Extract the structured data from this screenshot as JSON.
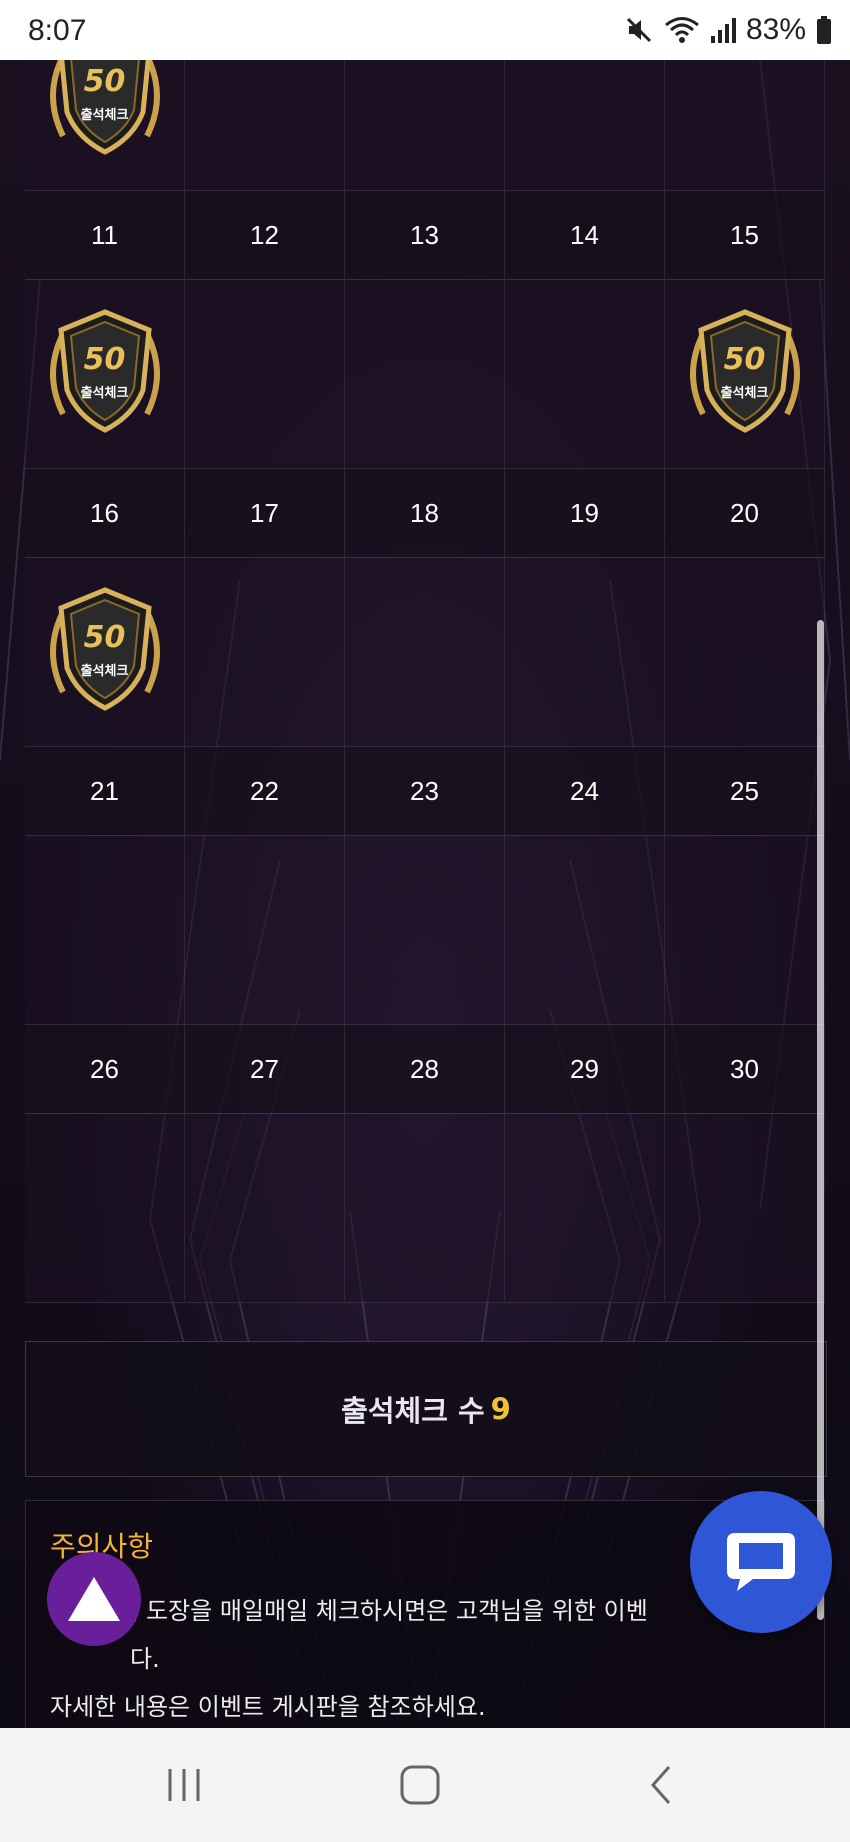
{
  "status_bar": {
    "time": "8:07",
    "battery": "83%",
    "icons": [
      "mute-icon",
      "wifi-icon",
      "signal-icon",
      "battery-icon"
    ]
  },
  "calendar": {
    "rows": [
      {
        "dates": [],
        "badges": [
          true,
          false,
          false,
          false,
          false
        ]
      },
      {
        "dates": [
          "11",
          "12",
          "13",
          "14",
          "15"
        ],
        "badges": [
          true,
          false,
          false,
          false,
          true
        ]
      },
      {
        "dates": [
          "16",
          "17",
          "18",
          "19",
          "20"
        ],
        "badges": [
          true,
          false,
          false,
          false,
          false
        ]
      },
      {
        "dates": [
          "21",
          "22",
          "23",
          "24",
          "25"
        ],
        "badges": [
          false,
          false,
          false,
          false,
          false
        ]
      },
      {
        "dates": [
          "26",
          "27",
          "28",
          "29",
          "30"
        ],
        "badges": [
          false,
          false,
          false,
          false,
          false
        ]
      }
    ],
    "badge": {
      "number": "50",
      "label": "출석체크",
      "icon": "attendance-badge-icon"
    }
  },
  "attendance_count": {
    "label": "출석체크 수",
    "value": "9"
  },
  "notice": {
    "title": "주의사항",
    "lines": [
      "출석부에 도장을 매일매일 체크하시면은 고객님을 위한 이벤",
      "다.",
      "자세한 내용은 이벤트 게시판을 참조하세요."
    ]
  },
  "floating": {
    "chat_icon": "chat-icon",
    "top_icon": "scroll-top-icon"
  },
  "nav": {
    "icons": [
      "recent-apps-icon",
      "home-icon",
      "back-icon"
    ]
  },
  "colors": {
    "accent_gold": "#f1c232",
    "notice_title": "#f3b23a",
    "chat_blue": "#2e56d6",
    "top_purple": "#6a1f9a"
  }
}
